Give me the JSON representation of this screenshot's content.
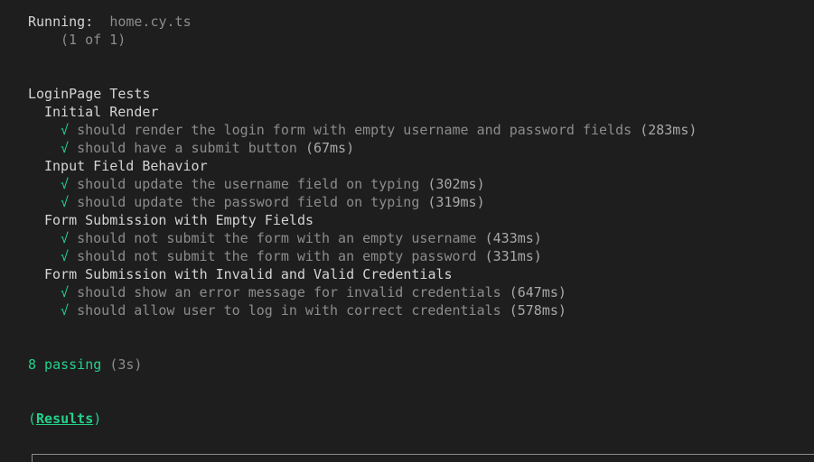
{
  "header": {
    "running_label": "Running:",
    "spec_file": "home.cy.ts",
    "spec_count": "(1 of 1)"
  },
  "suite": {
    "title": "LoginPage Tests",
    "check_mark": "√",
    "groups": [
      {
        "title": "Initial Render",
        "tests": [
          {
            "name": "should render the login form with empty username and password fields",
            "duration": "(283ms)"
          },
          {
            "name": "should have a submit button",
            "duration": "(67ms)"
          }
        ]
      },
      {
        "title": "Input Field Behavior",
        "tests": [
          {
            "name": "should update the username field on typing",
            "duration": "(302ms)"
          },
          {
            "name": "should update the password field on typing",
            "duration": "(319ms)"
          }
        ]
      },
      {
        "title": "Form Submission with Empty Fields",
        "tests": [
          {
            "name": "should not submit the form with an empty username",
            "duration": "(433ms)"
          },
          {
            "name": "should not submit the form with an empty password",
            "duration": "(331ms)"
          }
        ]
      },
      {
        "title": "Form Submission with Invalid and Valid Credentials",
        "tests": [
          {
            "name": "should show an error message for invalid credentials",
            "duration": "(647ms)"
          },
          {
            "name": "should allow user to log in with correct credentials",
            "duration": "(578ms)"
          }
        ]
      }
    ]
  },
  "summary": {
    "passing": "8 passing",
    "time": "(3s)"
  },
  "results": {
    "open_paren": "(",
    "label": "Results",
    "close_paren": ")"
  },
  "colors": {
    "background": "#1e1e1e",
    "text": "#d4d4d4",
    "pass_green": "#23d18b",
    "dim": "#8c8c8c"
  }
}
